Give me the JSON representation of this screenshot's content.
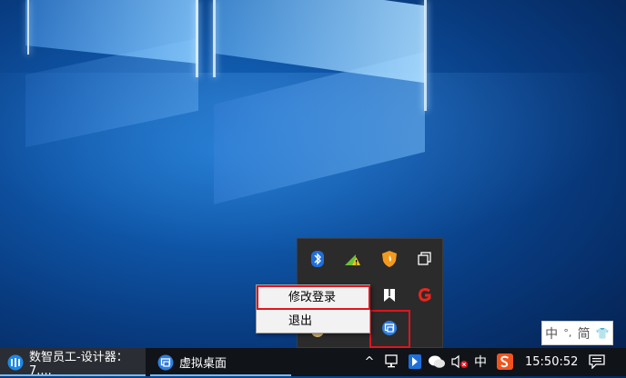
{
  "desktop": {
    "tray_overflow": {
      "icons": [
        "bluetooth-icon",
        "network-warning-icon",
        "shield-icon",
        "copy-window-icon",
        "bookmark-app-icon",
        "red-g-app-icon",
        "app-face-icon",
        "virtual-desktop-icon"
      ]
    },
    "context_menu": {
      "items": [
        {
          "label": "修改登录",
          "highlighted": true
        },
        {
          "label": "退出",
          "highlighted": false
        }
      ]
    },
    "ime_bar": {
      "lang": "中",
      "punct": "°,",
      "mode": "简",
      "skin": "👕"
    }
  },
  "taskbar": {
    "apps": [
      {
        "label": "数智员工-设计器：7....",
        "icon": "digital-employee-icon",
        "active": true
      },
      {
        "label": "虚拟桌面",
        "icon": "virtual-desktop-icon",
        "active": false
      }
    ],
    "tray": {
      "chevron": "^",
      "ime_indicator": "中",
      "clock": "15:50:52"
    }
  },
  "colors": {
    "highlight_red": "#e0141e",
    "taskbar_bg": "#101318",
    "accent_blue": "#76b9ed"
  }
}
